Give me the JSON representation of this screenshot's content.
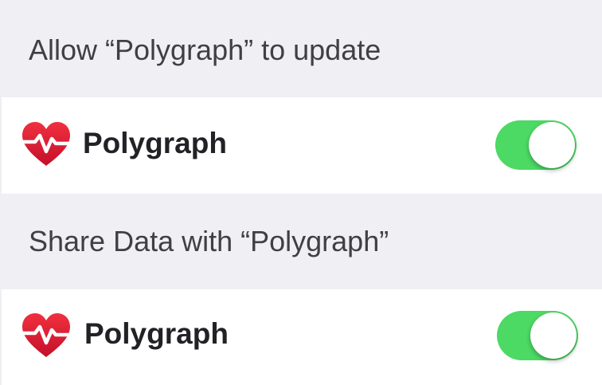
{
  "sections": [
    {
      "header": "Allow “Polygraph” to update",
      "row": {
        "app_name": "Polygraph",
        "app_icon": "heart-pulse-icon",
        "toggle_on": true
      }
    },
    {
      "header": "Share Data with “Polygraph”",
      "row": {
        "app_name": "Polygraph",
        "app_icon": "heart-pulse-icon",
        "toggle_on": true
      }
    }
  ],
  "colors": {
    "background": "#efeff4",
    "row_background": "#ffffff",
    "toggle_on": "#4cd964",
    "icon_red": "#d8182e"
  }
}
